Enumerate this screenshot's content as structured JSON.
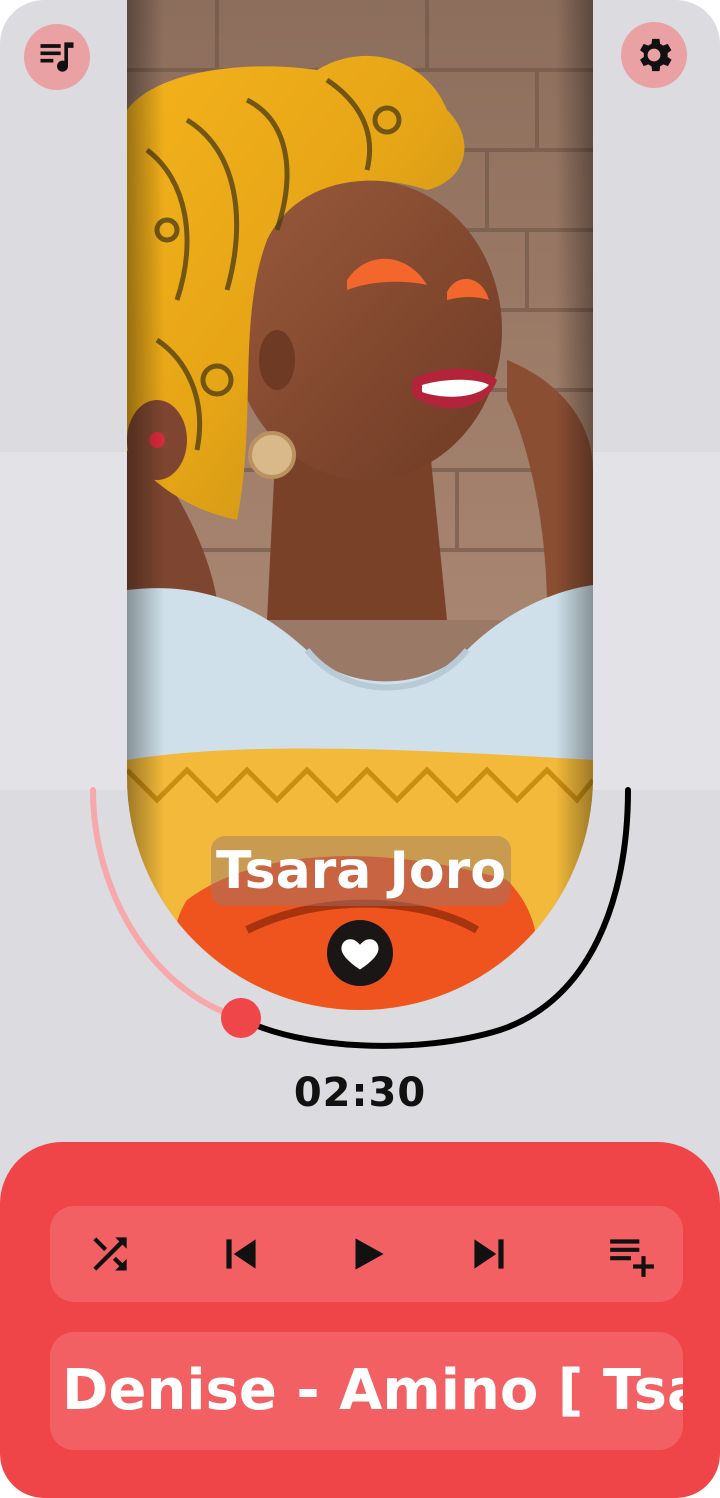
{
  "player": {
    "song_title": "Tsara Joro",
    "elapsed_time": "02:30",
    "now_playing": "Denise - Amino [ Tsara",
    "progress": 0.3,
    "liked": true
  },
  "icons": {
    "top_left": "playlist-music-icon",
    "top_right": "gear-icon",
    "like": "heart-icon",
    "shuffle": "shuffle-icon",
    "previous": "skip-previous-icon",
    "play": "play-icon",
    "next": "skip-next-icon",
    "queue": "playlist-add-icon"
  },
  "colors": {
    "background": "#dcdbdf",
    "accent": "#ef4548",
    "accent_light": "#f26063",
    "icon_button_bg": "#eaa1a4",
    "progress_played": "#f7a8aa",
    "progress_remaining": "#000000"
  }
}
